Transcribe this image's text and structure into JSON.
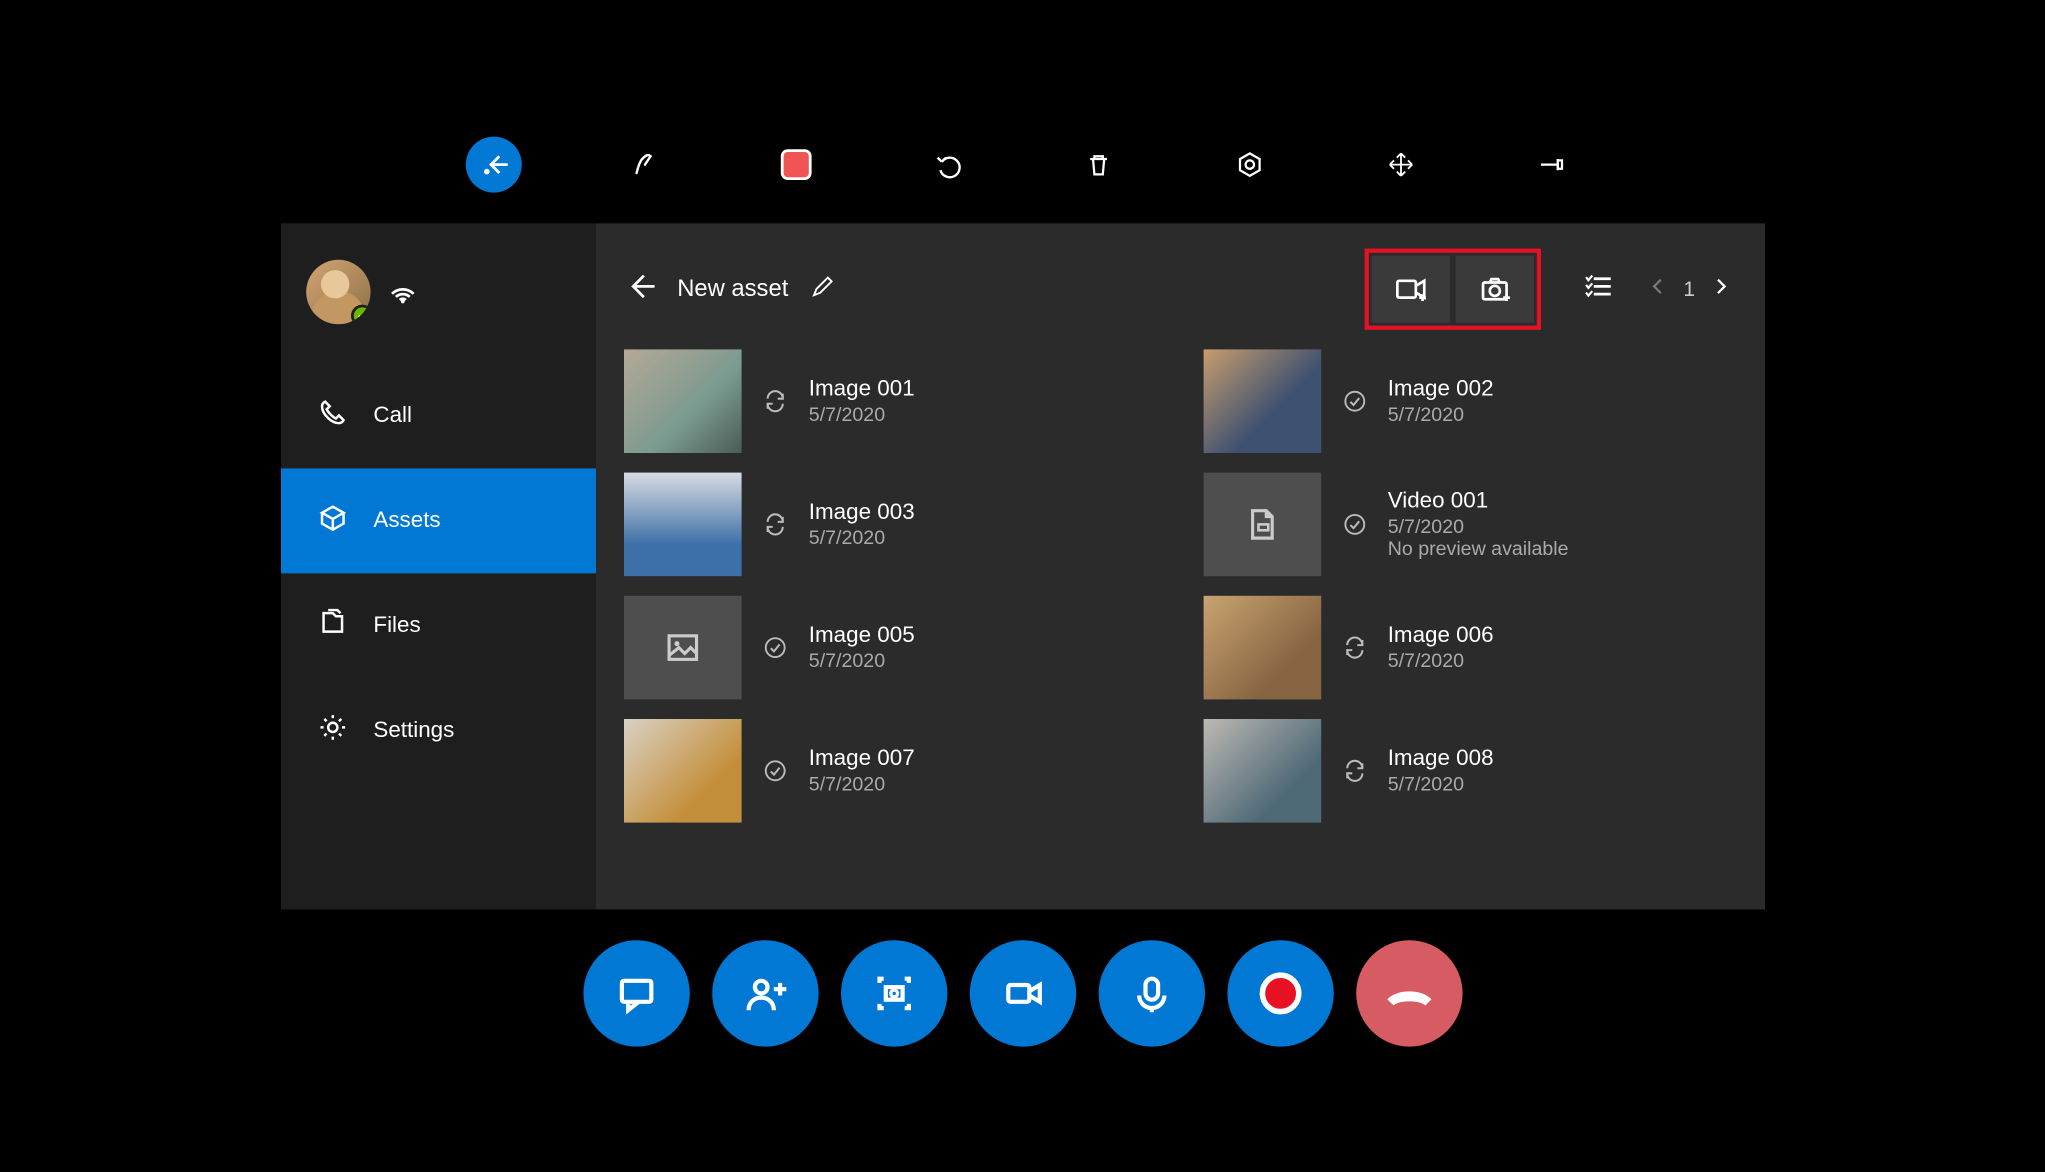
{
  "sidebar": {
    "items": [
      {
        "label": "Call"
      },
      {
        "label": "Assets"
      },
      {
        "label": "Files"
      },
      {
        "label": "Settings"
      }
    ]
  },
  "header": {
    "title": "New asset",
    "page": "1"
  },
  "assets": [
    {
      "title": "Image 001",
      "date": "5/7/2020",
      "sync": "refresh"
    },
    {
      "title": "Image 002",
      "date": "5/7/2020",
      "sync": "done"
    },
    {
      "title": "Image 003",
      "date": "5/7/2020",
      "sync": "refresh"
    },
    {
      "title": "Video 001",
      "date": "5/7/2020",
      "sync": "done",
      "note": "No preview available"
    },
    {
      "title": "Image 005",
      "date": "5/7/2020",
      "sync": "done"
    },
    {
      "title": "Image 006",
      "date": "5/7/2020",
      "sync": "refresh"
    },
    {
      "title": "Image 007",
      "date": "5/7/2020",
      "sync": "done"
    },
    {
      "title": "Image 008",
      "date": "5/7/2020",
      "sync": "refresh"
    }
  ]
}
